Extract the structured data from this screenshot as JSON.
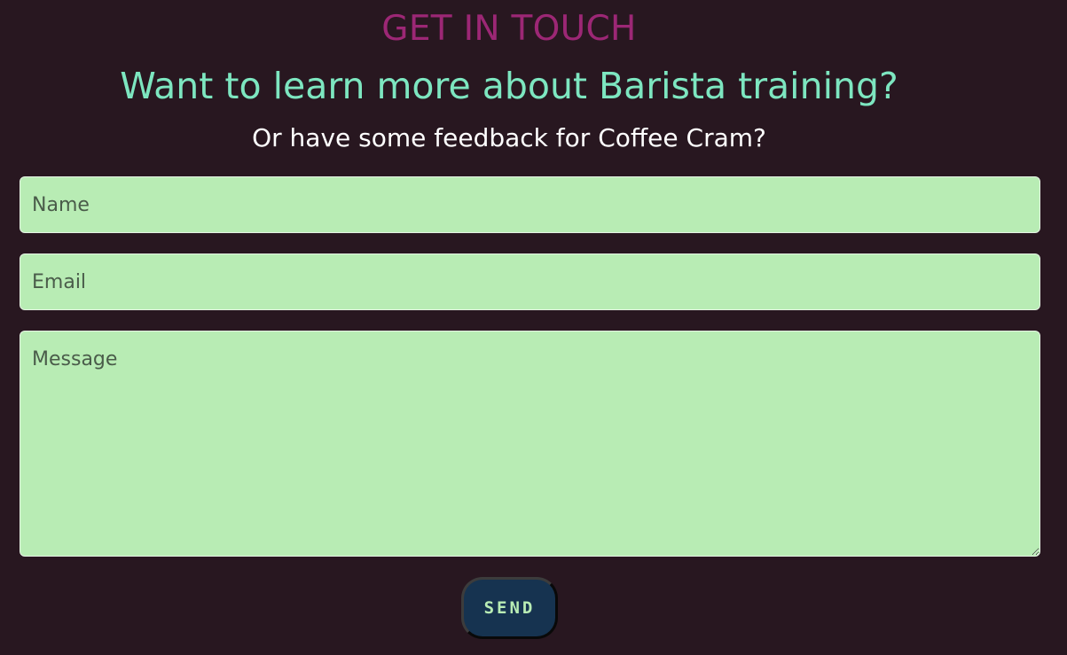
{
  "header": {
    "eyebrow": "GET IN TOUCH",
    "headline": "Want to learn more about Barista training?",
    "subhead": "Or have some feedback for Coffee Cram?"
  },
  "form": {
    "name_placeholder": "Name",
    "email_placeholder": "Email",
    "message_placeholder": "Message",
    "send_label": "SEND"
  },
  "colors": {
    "background": "#281720",
    "eyebrow": "#9c2775",
    "headline": "#7de6c0",
    "subhead": "#ffffff",
    "field_bg": "#b8ecb4",
    "button_bg": "#163350",
    "button_text": "#b8ecb4"
  }
}
